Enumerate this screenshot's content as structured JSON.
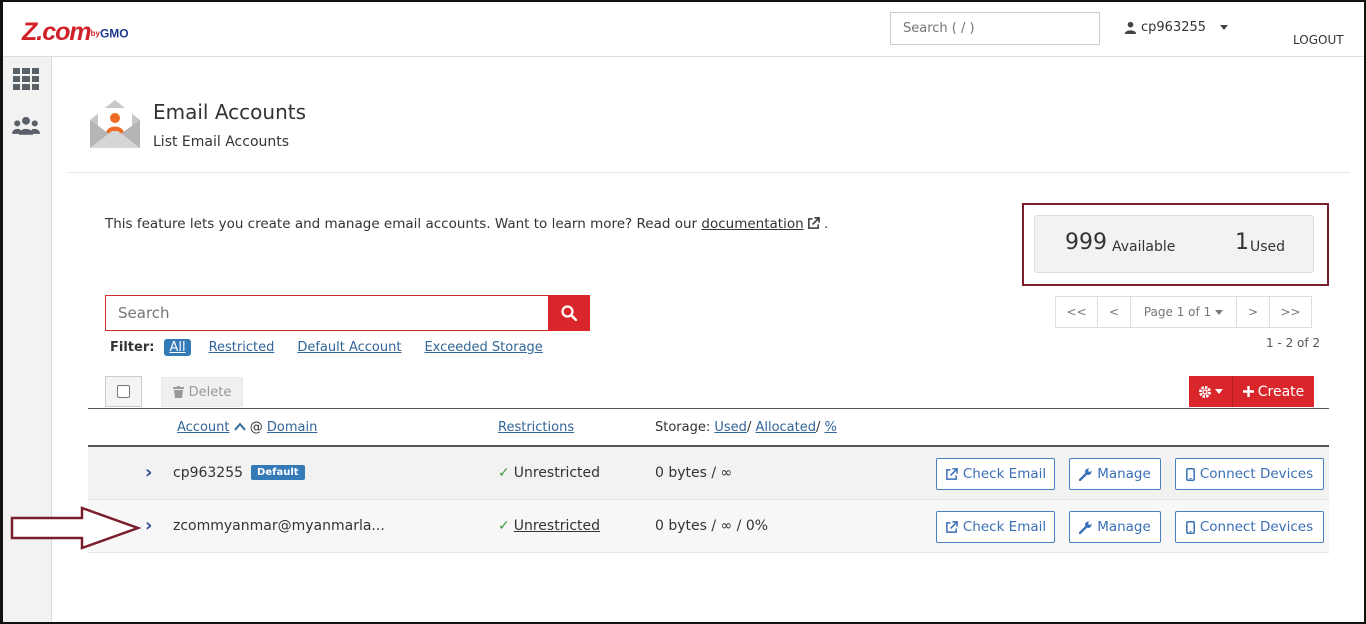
{
  "header": {
    "logo_main": "Z.com",
    "logo_by": "by",
    "logo_gmo": "GMO",
    "search_placeholder": "Search ( / )",
    "username": "cp963255",
    "logout_label": "LOGOUT"
  },
  "page": {
    "title": "Email Accounts",
    "subtitle": "List Email Accounts",
    "intro_text": "This feature lets you create and manage email accounts. Want to learn more? Read our ",
    "intro_link": "documentation",
    "intro_end": "."
  },
  "stats": {
    "available_count": "999",
    "available_label": "Available",
    "used_count": "1",
    "used_label": "Used"
  },
  "search": {
    "placeholder": "Search"
  },
  "filter": {
    "label": "Filter:",
    "options": [
      "All",
      "Restricted",
      "Default Account",
      "Exceeded Storage"
    ],
    "selected": "All"
  },
  "pagination": {
    "first": "<<",
    "prev": "<",
    "page_label": "Page 1 of 1",
    "next": ">",
    "last": ">>",
    "range": "1 - 2 of 2"
  },
  "toolbar": {
    "delete_label": "Delete",
    "create_label": "Create"
  },
  "table": {
    "col_account": "Account",
    "col_at": "@",
    "col_domain": "Domain",
    "col_restrictions": "Restrictions",
    "col_storage_prefix": "Storage:",
    "col_used": "Used",
    "col_sep1": "/",
    "col_allocated": "Allocated",
    "col_sep2": "/",
    "col_percent": "%",
    "rows": [
      {
        "account": "cp963255",
        "badge": "Default",
        "restriction": "Unrestricted",
        "storage": "0 bytes / ∞",
        "check_email": "Check Email",
        "manage": "Manage",
        "connect": "Connect Devices"
      },
      {
        "account": "zcommyanmar@myanmarla...",
        "restriction": "Unrestricted",
        "storage": "0 bytes / ∞ / 0%",
        "check_email": "Check Email",
        "manage": "Manage",
        "connect": "Connect Devices"
      }
    ]
  },
  "colors": {
    "brand_red": "#d9262b",
    "link_blue": "#336699",
    "annotation": "#7a1e2b"
  }
}
